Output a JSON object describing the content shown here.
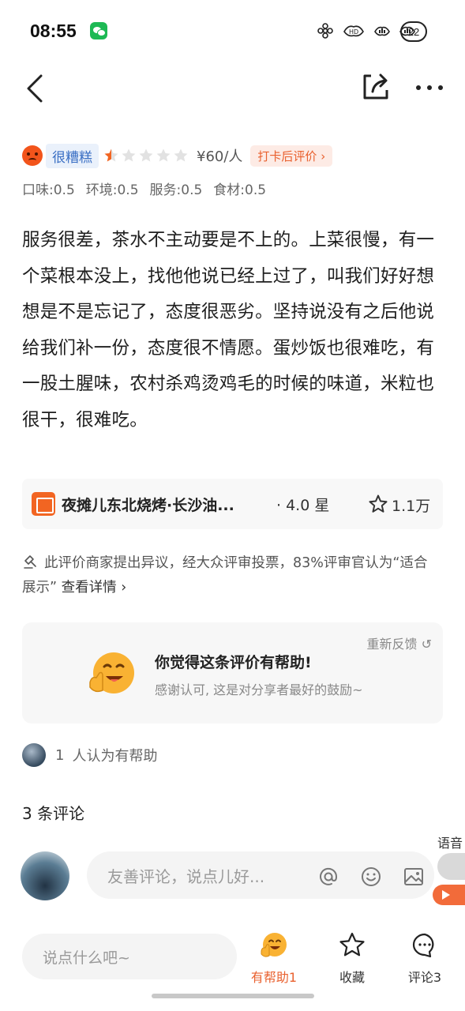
{
  "status_bar": {
    "time": "08:55",
    "battery": "22",
    "icons": [
      "wechat-icon",
      "flower-icon",
      "hd-icon",
      "signal-1-icon",
      "signal-2-icon"
    ]
  },
  "nav": {
    "back_icon": "chevron-left-icon",
    "share_icon": "share-icon",
    "more_icon": "more-icon"
  },
  "review": {
    "mood_label": "很糟糕",
    "stars_filled": 0.5,
    "stars_total": 5,
    "price": "¥60/人",
    "checkin_label": "打卡后评价",
    "scores": [
      "口味:0.5",
      "环境:0.5",
      "服务:0.5",
      "食材:0.5"
    ],
    "text": "服务很差，茶水不主动要是不上的。上菜很慢，有一个菜根本没上，找他他说已经上过了，叫我们好好想想是不是忘记了，态度很恶劣。坚持说没有之后他说给我们补一份，态度很不情愿。蛋炒饭也很难吃，有一股土腥味，农村杀鸡烫鸡毛的时候的味道，米粒也很干，很难吃。"
  },
  "shop": {
    "name": "夜摊儿东北烧烤·长沙油...",
    "rating": "· 4.0 星",
    "favorites": "1.1万"
  },
  "notice": {
    "text": "此评价商家提出异议，经大众评审投票，83%评审官认为“适合展示”",
    "link": "查看详情"
  },
  "feedback": {
    "refeedback_label": "重新反馈",
    "title": "你觉得这条评价有帮助!",
    "subtitle": "感谢认可, 这是对分享者最好的鼓励~"
  },
  "helpful": {
    "count": "1",
    "text": "人认为有帮助"
  },
  "comments": {
    "count_label": "3 条评论",
    "input_placeholder": "友善评论，说点儿好..."
  },
  "voice_float": {
    "label": "语音"
  },
  "bottom_bar": {
    "say_placeholder": "说点什么吧~",
    "tabs": [
      {
        "label": "有帮助1",
        "icon": "emoji-face-icon"
      },
      {
        "label": "收藏",
        "icon": "star-icon"
      },
      {
        "label": "评论3",
        "icon": "comment-icon"
      }
    ]
  },
  "colors": {
    "accent_orange": "#e9612f",
    "mood_blue": "#3a6fc4",
    "star_orange": "#f26522"
  }
}
